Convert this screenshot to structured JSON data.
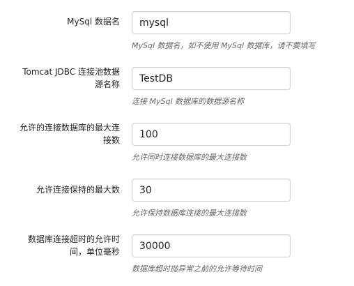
{
  "fields": [
    {
      "label": "MySql 数据名",
      "value": "mysql",
      "help": "MySql 数据名，如不使用 MySql 数据库，请不要填写"
    },
    {
      "label": "Tomcat JDBC 连接池数据源名称",
      "value": "TestDB",
      "help": "连接 MySql 数据库的数据源名称"
    },
    {
      "label": "允许的连接数据库的最大连接数",
      "value": "100",
      "help": "允许同时连接数据库的最大连接数"
    },
    {
      "label": "允许连接保持的最大数",
      "value": "30",
      "help": "允许保持数据库连接的最大连接数"
    },
    {
      "label": "数据库连接超时的允许时间，单位毫秒",
      "value": "30000",
      "help": "数据库超时抛异常之前的允许等待时间"
    }
  ]
}
